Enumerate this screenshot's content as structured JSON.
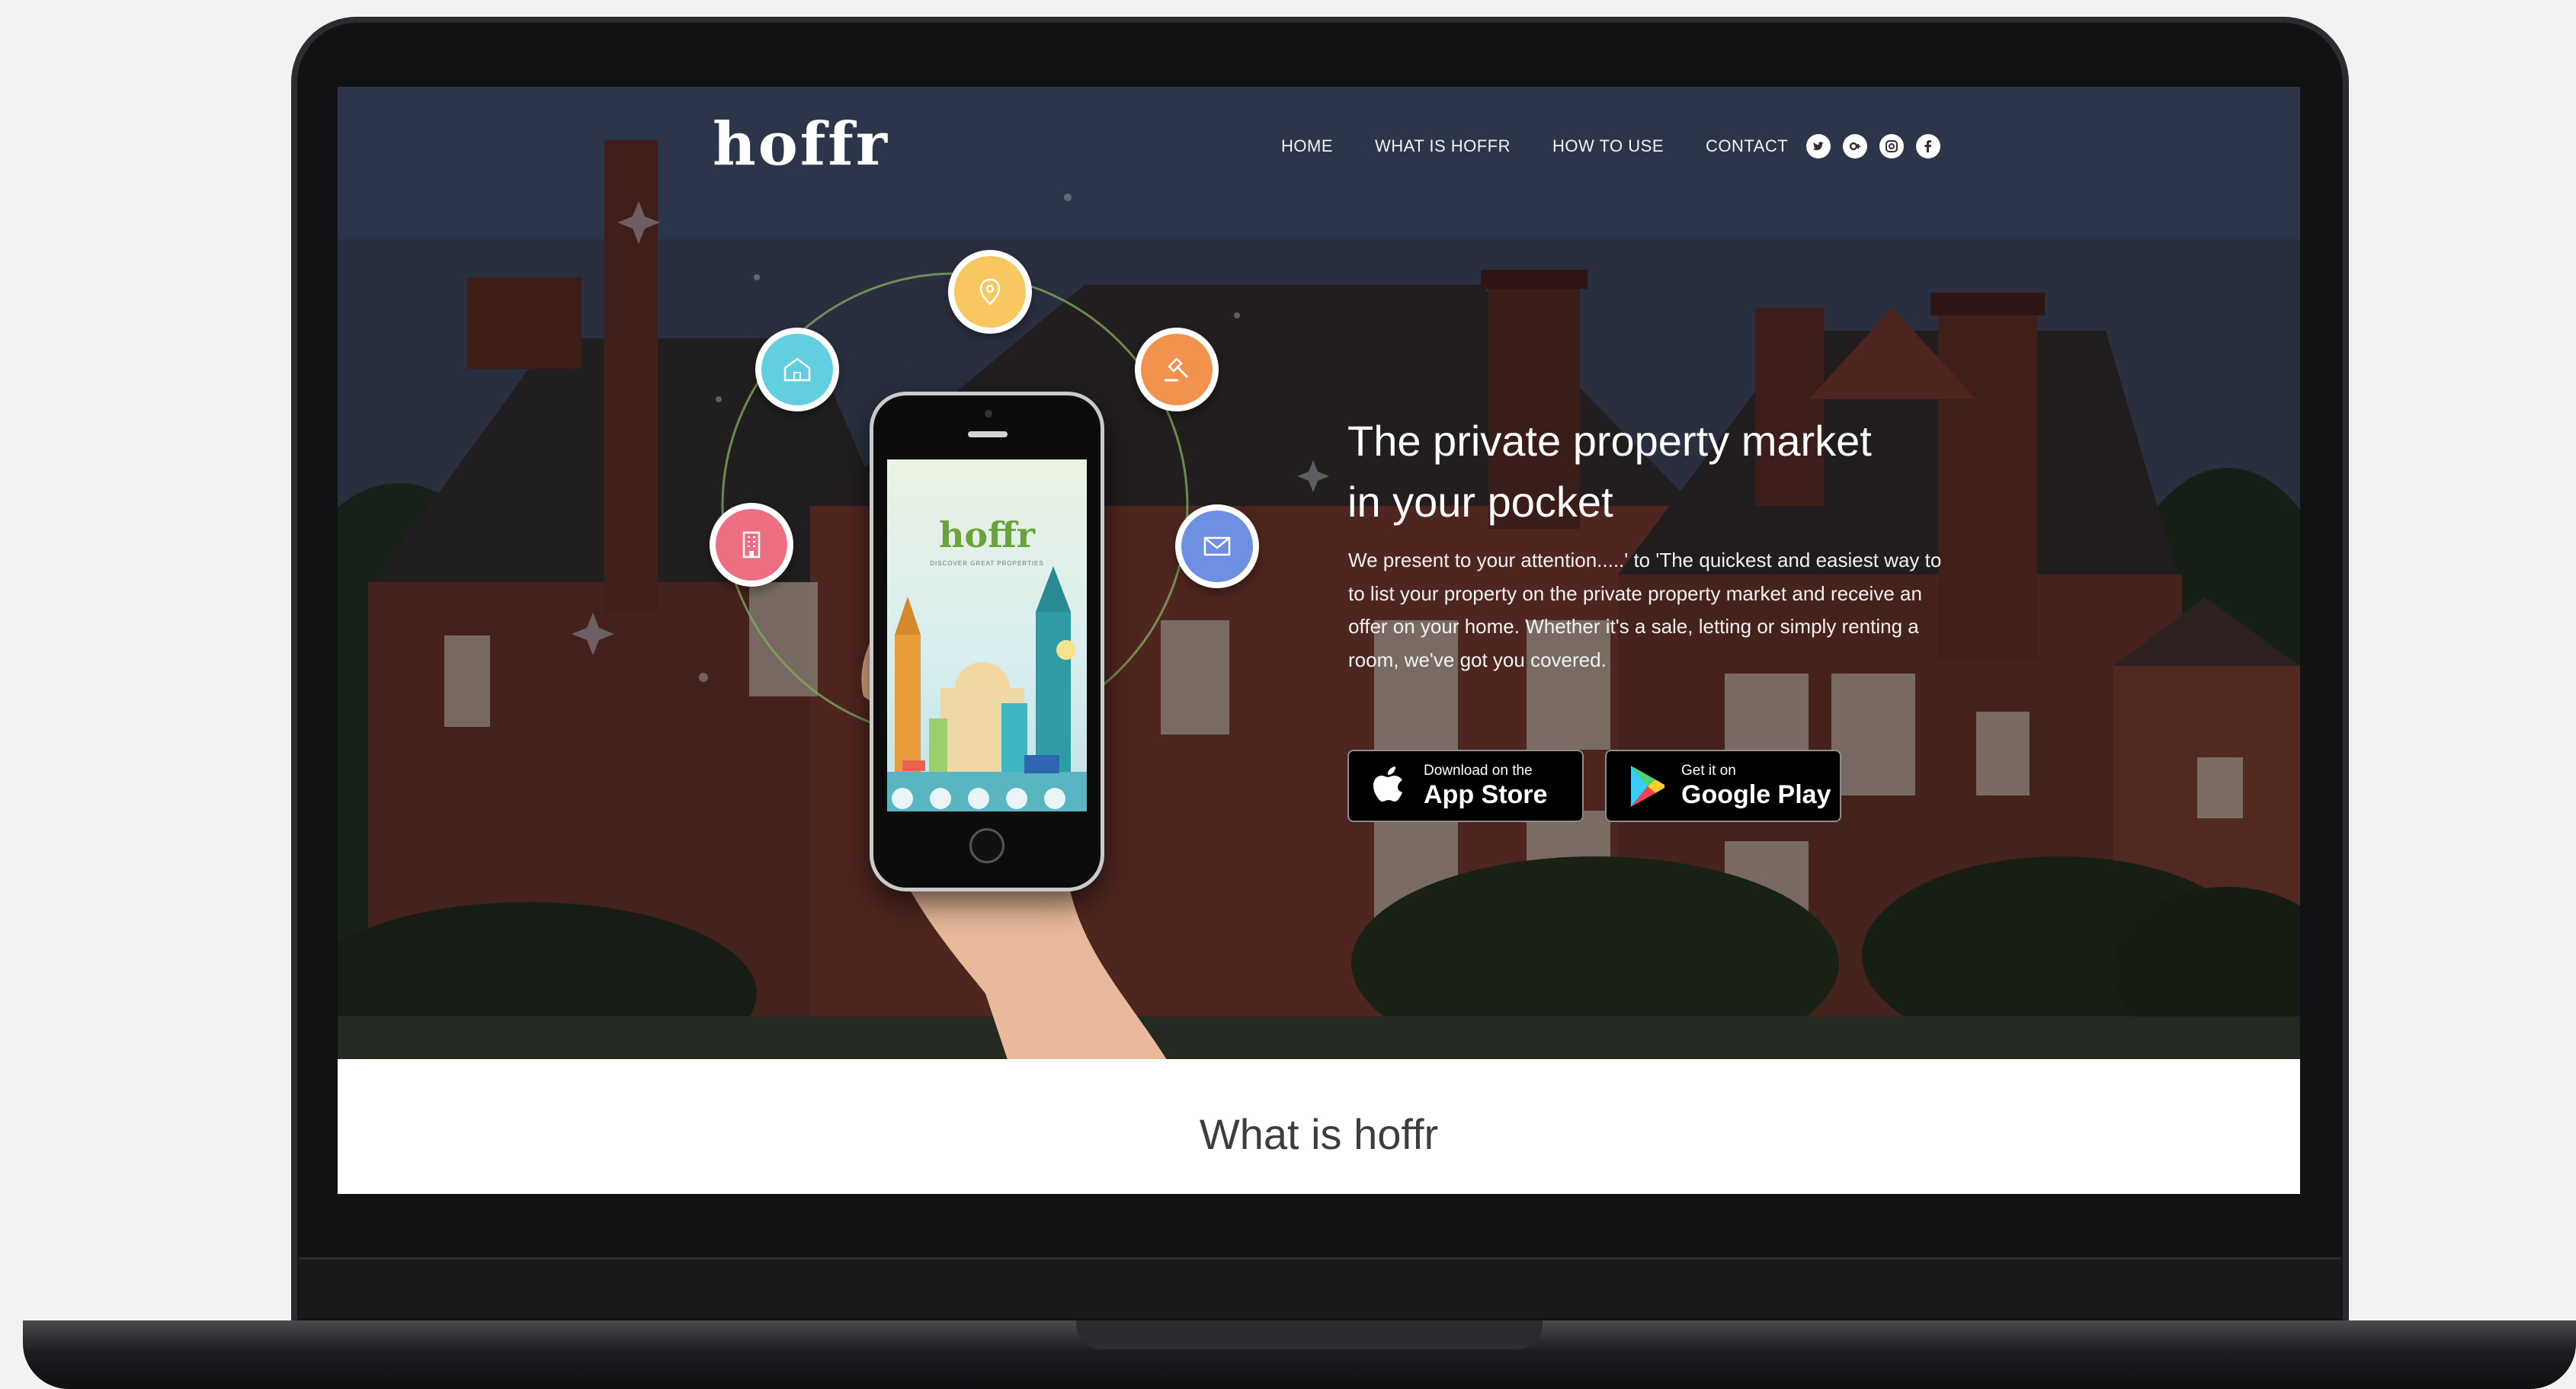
{
  "site": {
    "logo": "hoffr"
  },
  "nav": {
    "items": [
      {
        "label": "HOME"
      },
      {
        "label": "WHAT IS HOFFR"
      },
      {
        "label": "HOW TO USE"
      },
      {
        "label": "CONTACT"
      }
    ],
    "social": [
      {
        "icon": "twitter-icon"
      },
      {
        "icon": "google-plus-icon"
      },
      {
        "icon": "instagram-icon"
      },
      {
        "icon": "facebook-icon"
      }
    ]
  },
  "phone_app": {
    "logo": "hoffr",
    "tagline": "DISCOVER GREAT PROPERTIES"
  },
  "features": [
    {
      "icon": "location-pin-icon",
      "color": "#f9c760"
    },
    {
      "icon": "house-icon",
      "color": "#62cfe0"
    },
    {
      "icon": "gavel-icon",
      "color": "#f3924f"
    },
    {
      "icon": "building-icon",
      "color": "#ee6f82"
    },
    {
      "icon": "envelope-icon",
      "color": "#6f8fe3"
    }
  ],
  "hero": {
    "title_line1": "The private property market",
    "title_line2": "in your pocket",
    "description": "We present to your attention.....' to 'The quickest and easiest way to to list your property on the private property market and receive an offer on your home. Whether it's a sale, letting or simply renting a room, we've got you covered."
  },
  "stores": {
    "apple": {
      "small": "Download on the",
      "big": "App Store",
      "icon": "apple-icon"
    },
    "google": {
      "small": "Get it on",
      "big": "Google Play",
      "icon": "google-play-icon"
    }
  },
  "section": {
    "title": "What is hoffr"
  },
  "colors": {
    "accent_green": "#6aa23b",
    "text_dark": "#3d3d3d"
  }
}
